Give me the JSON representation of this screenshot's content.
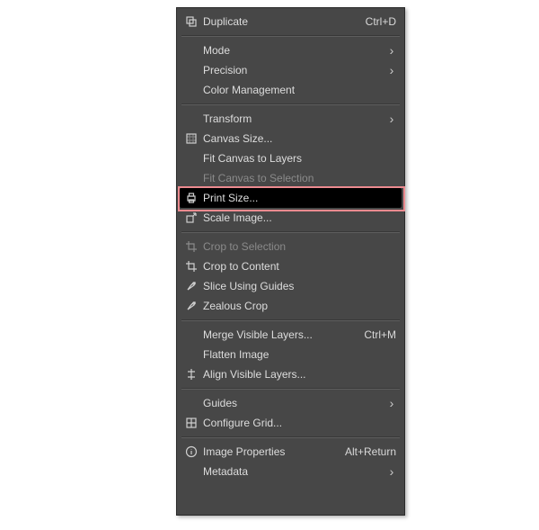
{
  "menu": {
    "sections": [
      {
        "items": [
          {
            "id": "duplicate",
            "icon": "duplicate-icon",
            "label": "Duplicate",
            "shortcut": "Ctrl+D",
            "submenu": false,
            "enabled": true
          }
        ]
      },
      {
        "items": [
          {
            "id": "mode",
            "icon": "",
            "label": "Mode",
            "shortcut": "",
            "submenu": true,
            "enabled": true
          },
          {
            "id": "precision",
            "icon": "",
            "label": "Precision",
            "shortcut": "",
            "submenu": true,
            "enabled": true
          },
          {
            "id": "color-management",
            "icon": "",
            "label": "Color Management",
            "shortcut": "",
            "submenu": false,
            "enabled": true
          }
        ]
      },
      {
        "items": [
          {
            "id": "transform",
            "icon": "",
            "label": "Transform",
            "shortcut": "",
            "submenu": true,
            "enabled": true
          },
          {
            "id": "canvas-size",
            "icon": "canvas-size-icon",
            "label": "Canvas Size...",
            "shortcut": "",
            "submenu": false,
            "enabled": true
          },
          {
            "id": "fit-canvas-layers",
            "icon": "",
            "label": "Fit Canvas to Layers",
            "shortcut": "",
            "submenu": false,
            "enabled": true
          },
          {
            "id": "fit-canvas-selection",
            "icon": "",
            "label": "Fit Canvas to Selection",
            "shortcut": "",
            "submenu": false,
            "enabled": false
          },
          {
            "id": "print-size",
            "icon": "print-icon",
            "label": "Print Size...",
            "shortcut": "",
            "submenu": false,
            "enabled": true,
            "highlight": true,
            "highlightBox": true
          },
          {
            "id": "scale-image",
            "icon": "scale-icon",
            "label": "Scale Image...",
            "shortcut": "",
            "submenu": false,
            "enabled": true
          }
        ]
      },
      {
        "items": [
          {
            "id": "crop-selection",
            "icon": "crop-icon",
            "label": "Crop to Selection",
            "shortcut": "",
            "submenu": false,
            "enabled": false
          },
          {
            "id": "crop-content",
            "icon": "crop-icon",
            "label": "Crop to Content",
            "shortcut": "",
            "submenu": false,
            "enabled": true
          },
          {
            "id": "slice-guides",
            "icon": "slice-icon",
            "label": "Slice Using Guides",
            "shortcut": "",
            "submenu": false,
            "enabled": true
          },
          {
            "id": "zealous-crop",
            "icon": "slice-icon",
            "label": "Zealous Crop",
            "shortcut": "",
            "submenu": false,
            "enabled": true
          }
        ]
      },
      {
        "items": [
          {
            "id": "merge-visible",
            "icon": "",
            "label": "Merge Visible Layers...",
            "shortcut": "Ctrl+M",
            "submenu": false,
            "enabled": true
          },
          {
            "id": "flatten-image",
            "icon": "",
            "label": "Flatten Image",
            "shortcut": "",
            "submenu": false,
            "enabled": true
          },
          {
            "id": "align-visible",
            "icon": "align-icon",
            "label": "Align Visible Layers...",
            "shortcut": "",
            "submenu": false,
            "enabled": true
          }
        ]
      },
      {
        "items": [
          {
            "id": "guides",
            "icon": "",
            "label": "Guides",
            "shortcut": "",
            "submenu": true,
            "enabled": true
          },
          {
            "id": "configure-grid",
            "icon": "grid-icon",
            "label": "Configure Grid...",
            "shortcut": "",
            "submenu": false,
            "enabled": true
          }
        ]
      },
      {
        "items": [
          {
            "id": "image-properties",
            "icon": "info-icon",
            "label": "Image Properties",
            "shortcut": "Alt+Return",
            "submenu": false,
            "enabled": true
          },
          {
            "id": "metadata",
            "icon": "",
            "label": "Metadata",
            "shortcut": "",
            "submenu": true,
            "enabled": true
          }
        ]
      }
    ]
  }
}
